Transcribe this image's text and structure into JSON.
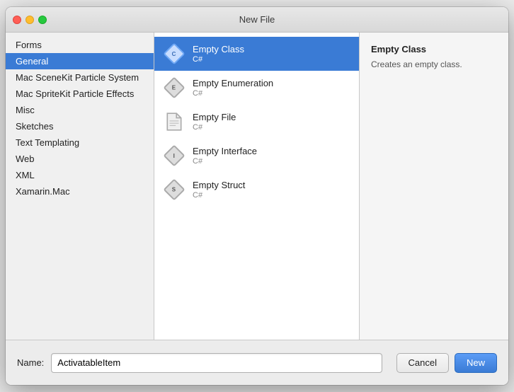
{
  "window": {
    "title": "New File"
  },
  "sidebar": {
    "items": [
      {
        "label": "Forms",
        "selected": false
      },
      {
        "label": "General",
        "selected": true
      },
      {
        "label": "Mac SceneKit Particle System",
        "selected": false
      },
      {
        "label": "Mac SpriteKit Particle Effects",
        "selected": false
      },
      {
        "label": "Misc",
        "selected": false
      },
      {
        "label": "Sketches",
        "selected": false
      },
      {
        "label": "Text Templating",
        "selected": false
      },
      {
        "label": "Web",
        "selected": false
      },
      {
        "label": "XML",
        "selected": false
      },
      {
        "label": "Xamarin.Mac",
        "selected": false
      }
    ]
  },
  "file_list": {
    "items": [
      {
        "name": "Empty Class",
        "sub": "C#",
        "icon_type": "blue",
        "selected": true
      },
      {
        "name": "Empty Enumeration",
        "sub": "C#",
        "icon_type": "purple",
        "selected": false
      },
      {
        "name": "Empty File",
        "sub": "C#",
        "icon_type": "gray",
        "selected": false
      },
      {
        "name": "Empty Interface",
        "sub": "C#",
        "icon_type": "orange",
        "selected": false
      },
      {
        "name": "Empty Struct",
        "sub": "C#",
        "icon_type": "green",
        "selected": false
      }
    ]
  },
  "detail": {
    "title": "Empty Class",
    "description": "Creates an empty class."
  },
  "bottom": {
    "name_label": "Name:",
    "name_value": "ActivatableItem",
    "cancel_label": "Cancel",
    "new_label": "New"
  }
}
